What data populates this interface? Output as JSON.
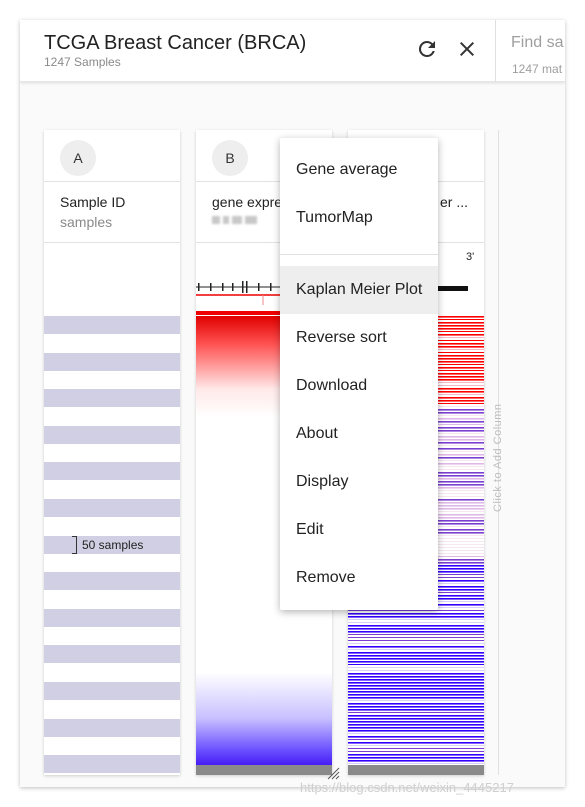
{
  "header": {
    "title": "TCGA Breast Cancer (BRCA)",
    "subtitle": "1247 Samples",
    "refresh_icon": "refresh-icon",
    "close_icon": "close-icon",
    "find_placeholder": "Find sa",
    "find_sub": "1247 mat"
  },
  "columns": {
    "a": {
      "badge": "A",
      "field": "Sample ID",
      "sub": "samples",
      "tag": "50 samples"
    },
    "b": {
      "badge": "B",
      "field": "gene expre"
    },
    "c": {
      "field": "er ..."
    }
  },
  "gene_model": {
    "end_label": "3'"
  },
  "add_column": {
    "label": "Click to Add Column"
  },
  "menu": {
    "items": [
      {
        "label": "Gene average"
      },
      {
        "label": "TumorMap"
      },
      {
        "label": "Kaplan Meier Plot",
        "active": true
      },
      {
        "label": "Reverse sort"
      },
      {
        "label": "Download"
      },
      {
        "label": "About"
      },
      {
        "label": "Display"
      },
      {
        "label": "Edit"
      },
      {
        "label": "Remove"
      }
    ]
  },
  "colors": {
    "stripe": "#d0cfe3",
    "high": "#ff0000",
    "low": "#3300ff",
    "purple": "#7a3fd0"
  },
  "watermark": "https://blog.csdn.net/weixin_4445217"
}
